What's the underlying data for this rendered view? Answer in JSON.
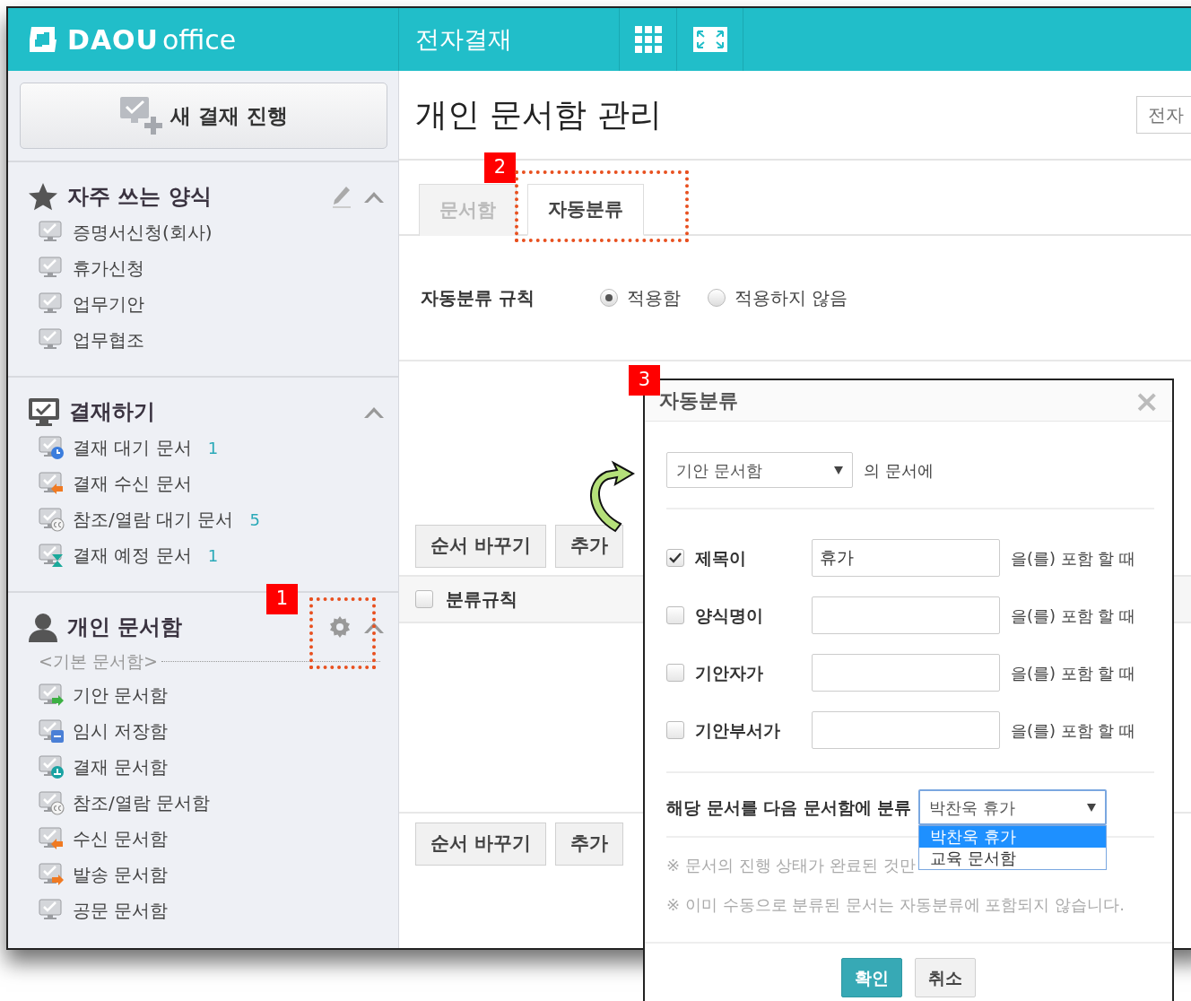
{
  "topbar": {
    "logo_main": "DAOU",
    "logo_sub": "office",
    "module": "전자결재"
  },
  "sidebar": {
    "new_button": "새 결재 진행",
    "sections": [
      {
        "title": "자주 쓰는 양식",
        "kind": "favorites",
        "items": [
          {
            "label": "증명서신청(회사)",
            "kind": "plain"
          },
          {
            "label": "휴가신청",
            "kind": "plain"
          },
          {
            "label": "업무기안",
            "kind": "plain"
          },
          {
            "label": "업무협조",
            "kind": "plain"
          }
        ]
      },
      {
        "title": "결재하기",
        "kind": "approval",
        "items": [
          {
            "label": "결재 대기 문서",
            "count": "1",
            "kind": "waiting"
          },
          {
            "label": "결재 수신 문서",
            "kind": "received"
          },
          {
            "label": "참조/열람 대기 문서",
            "count": "5",
            "kind": "cc"
          },
          {
            "label": "결재 예정 문서",
            "count": "1",
            "kind": "scheduled"
          }
        ]
      },
      {
        "title": "개인 문서함",
        "kind": "personal",
        "subheading": "<기본 문서함>",
        "items": [
          {
            "label": "기안 문서함",
            "kind": "draft"
          },
          {
            "label": "임시 저장함",
            "kind": "temp"
          },
          {
            "label": "결재 문서함",
            "kind": "approved"
          },
          {
            "label": "참조/열람 문서함",
            "kind": "cc"
          },
          {
            "label": "수신 문서함",
            "kind": "received"
          },
          {
            "label": "발송 문서함",
            "kind": "sent"
          },
          {
            "label": "공문 문서함",
            "kind": "plain"
          }
        ]
      }
    ]
  },
  "main": {
    "title": "개인 문서함 관리",
    "header_button": "전자",
    "tabs": [
      {
        "label": "문서함",
        "selected": false
      },
      {
        "label": "자동분류",
        "selected": true
      }
    ],
    "rule": {
      "label": "자동분류 규칙",
      "options": [
        {
          "label": "적용함",
          "selected": true
        },
        {
          "label": "적용하지 않음",
          "selected": false
        }
      ]
    },
    "toolbar_buttons": [
      "순서 바꾸기",
      "추가"
    ],
    "table_header": {
      "label": "분류규칙",
      "checked": false
    },
    "bottom_buttons": [
      "순서 바꾸기",
      "추가"
    ]
  },
  "dialog": {
    "title": "자동분류",
    "close": "×",
    "source": {
      "value": "기안 문서함",
      "suffix": "의 문서에"
    },
    "conditions": [
      {
        "label": "제목이",
        "checked": true,
        "value": "휴가",
        "suffix": "을(를) 포함 할 때"
      },
      {
        "label": "양식명이",
        "checked": false,
        "suffix": "을(를) 포함 할 때"
      },
      {
        "label": "기안자가",
        "checked": false,
        "suffix": "을(를) 포함 할 때"
      },
      {
        "label": "기안부서가",
        "checked": false,
        "suffix": "을(를) 포함 할 때"
      }
    ],
    "target": {
      "label": "해당 문서를 다음 문서함에 분류",
      "value": "박찬욱 휴가",
      "expanded": true,
      "options": [
        {
          "label": "박찬욱 휴가",
          "selected": true
        },
        {
          "label": "교육 문서함",
          "selected": false
        }
      ]
    },
    "notes": [
      "※ 문서의 진행 상태가 완료된 것만",
      "※ 이미 수동으로 분류된 문서는 자동분류에 포함되지 않습니다."
    ],
    "buttons": [
      {
        "label": "확인",
        "kind": "primary"
      },
      {
        "label": "취소",
        "kind": "secondary"
      }
    ]
  },
  "callouts": [
    {
      "label": "1"
    },
    {
      "label": "2"
    },
    {
      "label": "3"
    }
  ]
}
